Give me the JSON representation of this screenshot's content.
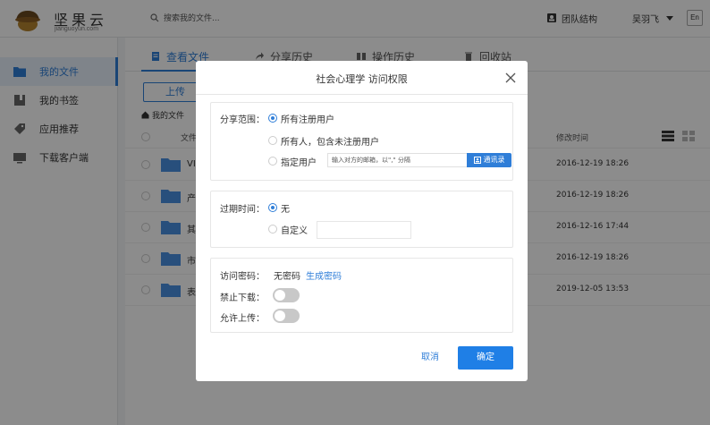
{
  "app": {
    "logo_text": "坚果云",
    "logo_sub": "jianguoyun.com",
    "search_placeholder": "搜索我的文件...",
    "team_label": "团队结构",
    "user_name": "吴羽飞",
    "lang": "En"
  },
  "sidebar": {
    "items": [
      {
        "label": "我的文件",
        "icon": "folder-icon"
      },
      {
        "label": "我的书签",
        "icon": "bookmark-icon"
      },
      {
        "label": "应用推荐",
        "icon": "tag-icon"
      },
      {
        "label": "下载客户端",
        "icon": "monitor-icon"
      }
    ]
  },
  "main": {
    "tabs": [
      {
        "label": "查看文件",
        "icon": "file-icon"
      },
      {
        "label": "分享历史",
        "icon": "share-icon"
      },
      {
        "label": "操作历史",
        "icon": "history-icon"
      },
      {
        "label": "回收站",
        "icon": "trash-icon"
      }
    ],
    "upload_label": "上传",
    "breadcrumb": "我的文件",
    "col_name": "文件",
    "col_time": "修改时间",
    "rows": [
      {
        "name": "VI",
        "time": "2016-12-19 18:26"
      },
      {
        "name": "产",
        "time": "2016-12-19 18:26"
      },
      {
        "name": "其",
        "time": "2016-12-16 17:44"
      },
      {
        "name": "市",
        "time": "2016-12-19 18:26"
      },
      {
        "name": "表",
        "time": "2019-12-05 13:53"
      }
    ]
  },
  "modal": {
    "title": "社会心理学 访问权限",
    "scope_label": "分享范围：",
    "scope_options": [
      "所有注册用户",
      "所有人，包含未注册用户",
      "指定用户"
    ],
    "email_placeholder": "输入对方的邮箱，以\",\" 分隔",
    "contacts_label": "通讯录",
    "expire_label": "过期时间：",
    "expire_options": [
      "无",
      "自定义"
    ],
    "password_label": "访问密码：",
    "password_value": "无密码",
    "generate_label": "生成密码",
    "no_download_label": "禁止下载：",
    "allow_upload_label": "允许上传：",
    "cancel_label": "取消",
    "ok_label": "确定"
  },
  "colors": {
    "accent": "#2f7ed8",
    "primary_button": "#1f7fe6",
    "overlay": "rgba(0,0,0,0.45)"
  }
}
